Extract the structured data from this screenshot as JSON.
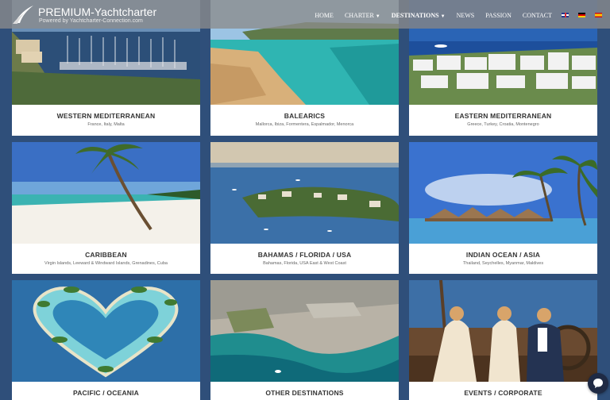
{
  "header": {
    "brand": "PREMIUM-Yachtcharter",
    "tagline": "Powered by Yachtcharter-Connection.com",
    "nav": [
      {
        "label": "HOME",
        "dropdown": false,
        "active": false
      },
      {
        "label": "CHARTER",
        "dropdown": true,
        "active": false
      },
      {
        "label": "DESTINATIONS",
        "dropdown": true,
        "active": true
      },
      {
        "label": "NEWS",
        "dropdown": false,
        "active": false
      },
      {
        "label": "PASSION",
        "dropdown": false,
        "active": false
      },
      {
        "label": "CONTACT",
        "dropdown": false,
        "active": false
      }
    ],
    "flags": [
      "uk-flag-icon",
      "germany-flag-icon",
      "spain-flag-icon"
    ]
  },
  "destinations": [
    {
      "title": "WESTERN MEDITERRANEAN",
      "subtitle": "France, Italy, Malta"
    },
    {
      "title": "BALEARICS",
      "subtitle": "Mallorca, Ibiza, Formentera, Espalmador, Menorca"
    },
    {
      "title": "EASTERN MEDITERRANEAN",
      "subtitle": "Greece, Turkey, Croatia, Montenegro"
    },
    {
      "title": "CARIBBEAN",
      "subtitle": "Virgin Islands, Leeward & Windward Islands, Grenadines, Cuba"
    },
    {
      "title": "BAHAMAS / FLORIDA / USA",
      "subtitle": "Bahamas, Florida, USA East & West Coast"
    },
    {
      "title": "INDIAN OCEAN / ASIA",
      "subtitle": "Thailand, Seychelles, Myanmar, Maldives"
    },
    {
      "title": "PACIFIC / OCEANIA",
      "subtitle": ""
    },
    {
      "title": "OTHER DESTINATIONS",
      "subtitle": ""
    },
    {
      "title": "EVENTS / CORPORATE",
      "subtitle": ""
    }
  ],
  "chat": {
    "icon": "chat-bubble-icon"
  },
  "colors": {
    "background": "#2f4f7a",
    "header": "#8c8c8c",
    "card": "#ffffff",
    "title": "#333333"
  }
}
